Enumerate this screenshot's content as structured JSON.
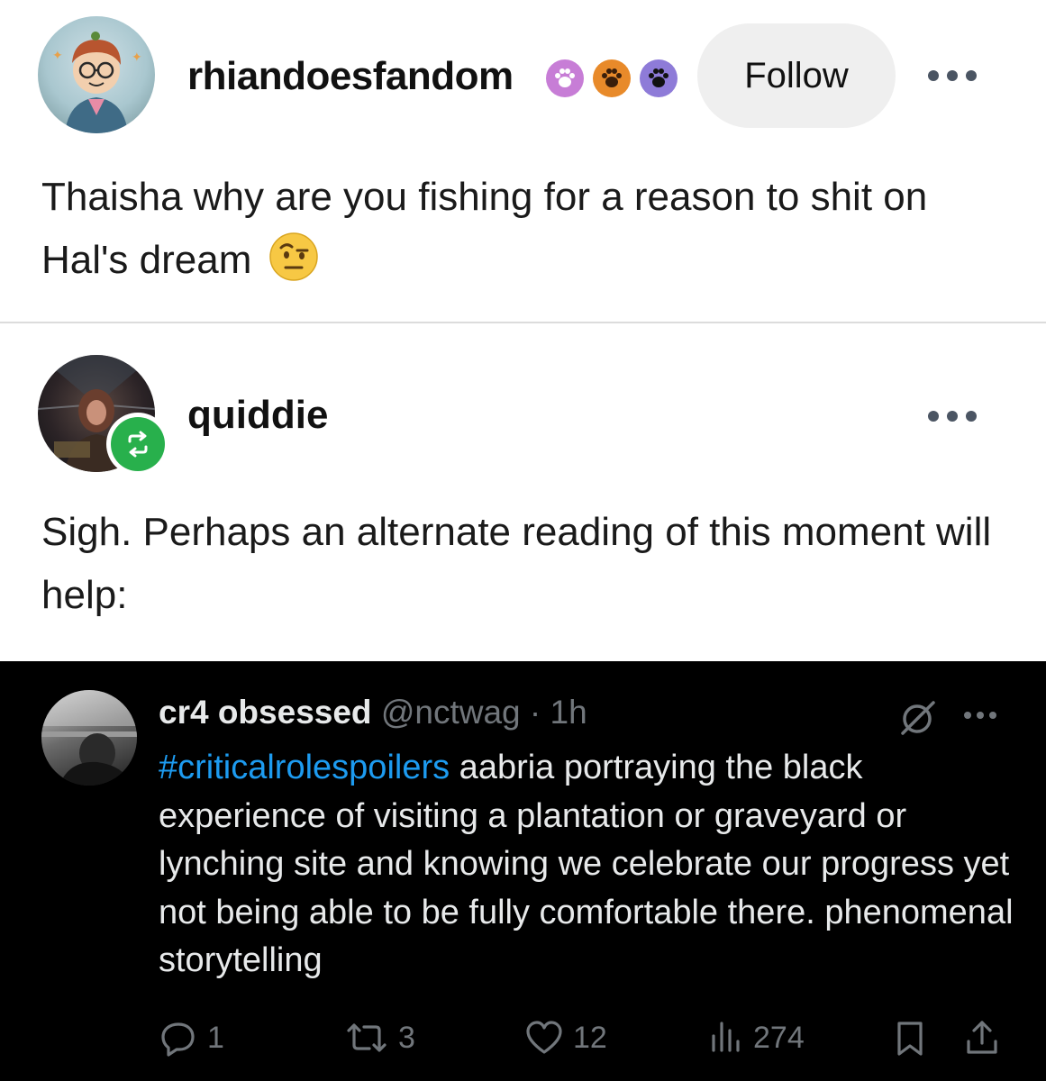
{
  "post1": {
    "username": "rhiandoesfandom",
    "badges": [
      {
        "icon": "paw-badge-icon",
        "color": "#c77dd6"
      },
      {
        "icon": "paw-badge-icon",
        "color": "#e88a2a"
      },
      {
        "icon": "paw-badge-icon",
        "color": "#8e7bd8"
      }
    ],
    "follow_label": "Follow",
    "text": "Thaisha why are you fishing for a reason to shit on Hal's dream",
    "emoji": "face-with-raised-eyebrow-icon"
  },
  "post2": {
    "username": "quiddie",
    "reblog_icon": "reblog-icon",
    "text": "Sigh. Perhaps an alternate reading of this moment will help:"
  },
  "tweet": {
    "name": "cr4 obsessed",
    "handle": "@nctwag",
    "separator": "·",
    "time": "1h",
    "hashtag": "#criticalrolespoilers",
    "body": " aabria portraying the black experience of visiting a plantation or graveyard or lynching site and knowing we celebrate our progress yet not being able to be fully comfortable there. phenomenal storytelling",
    "actions": {
      "replies": "1",
      "reposts": "3",
      "likes": "12",
      "views": "274"
    }
  },
  "colors": {
    "tumblr_green": "#28b04c",
    "twitter_blue": "#1d9bf0",
    "twitter_muted": "#71767b",
    "follow_bg": "#efefef"
  }
}
